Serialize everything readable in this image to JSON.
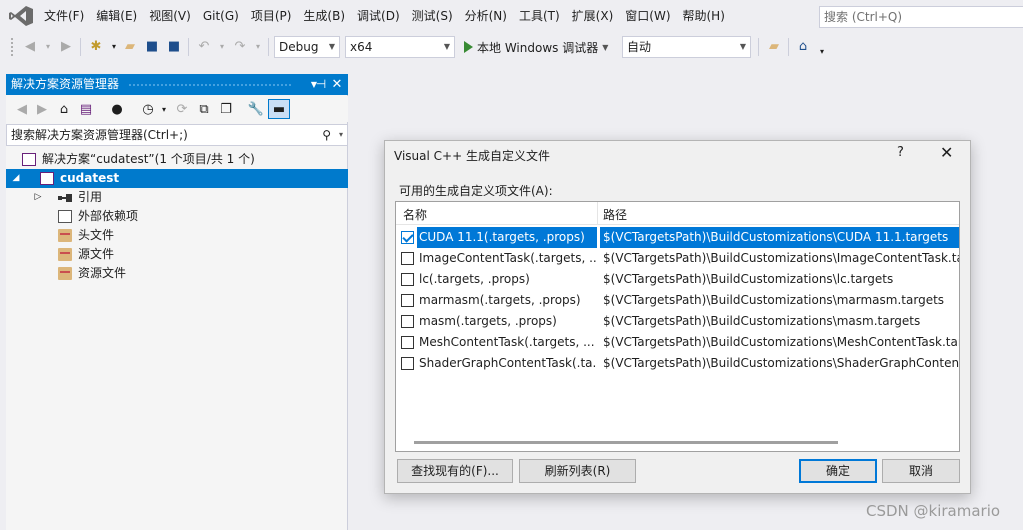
{
  "menu": {
    "items": [
      "文件(F)",
      "编辑(E)",
      "视图(V)",
      "Git(G)",
      "项目(P)",
      "生成(B)",
      "调试(D)",
      "测试(S)",
      "分析(N)",
      "工具(T)",
      "扩展(X)",
      "窗口(W)",
      "帮助(H)"
    ],
    "search_placeholder": "搜索 (Ctrl+Q)"
  },
  "toolbar": {
    "config": "Debug",
    "platform": "x64",
    "run_label": "本地 Windows 调试器",
    "run_mode": "自动"
  },
  "solution_explorer": {
    "title": "解决方案资源管理器",
    "search_placeholder": "搜索解决方案资源管理器(Ctrl+;)",
    "solution_label": "解决方案“cudatest”(1 个项目/共 1 个)",
    "project_label": "cudatest",
    "nodes": [
      "引用",
      "外部依赖项",
      "头文件",
      "源文件",
      "资源文件"
    ]
  },
  "dialog": {
    "title": "Visual C++ 生成自定义文件",
    "help": "?",
    "list_caption": "可用的生成自定义项文件(A):",
    "col_name": "名称",
    "col_path": "路径",
    "rows": [
      {
        "name": "CUDA 11.1(.targets, .props)",
        "path": "$(VCTargetsPath)\\BuildCustomizations\\CUDA 11.1.targets",
        "checked": true
      },
      {
        "name": "ImageContentTask(.targets, ...",
        "path": "$(VCTargetsPath)\\BuildCustomizations\\ImageContentTask.tar",
        "checked": false
      },
      {
        "name": "lc(.targets, .props)",
        "path": "$(VCTargetsPath)\\BuildCustomizations\\lc.targets",
        "checked": false
      },
      {
        "name": "marmasm(.targets, .props)",
        "path": "$(VCTargetsPath)\\BuildCustomizations\\marmasm.targets",
        "checked": false
      },
      {
        "name": "masm(.targets, .props)",
        "path": "$(VCTargetsPath)\\BuildCustomizations\\masm.targets",
        "checked": false
      },
      {
        "name": "MeshContentTask(.targets, ...",
        "path": "$(VCTargetsPath)\\BuildCustomizations\\MeshContentTask.targ",
        "checked": false
      },
      {
        "name": "ShaderGraphContentTask(.ta...",
        "path": "$(VCTargetsPath)\\BuildCustomizations\\ShaderGraphContentT",
        "checked": false
      }
    ],
    "btn_find": "查找现有的(F)...",
    "btn_refresh": "刷新列表(R)",
    "btn_ok": "确定",
    "btn_cancel": "取消"
  },
  "watermark": "CSDN @kiramario",
  "colors": {
    "accent": "#007acc",
    "selection": "#0078d7",
    "run_green": "#388a34"
  }
}
